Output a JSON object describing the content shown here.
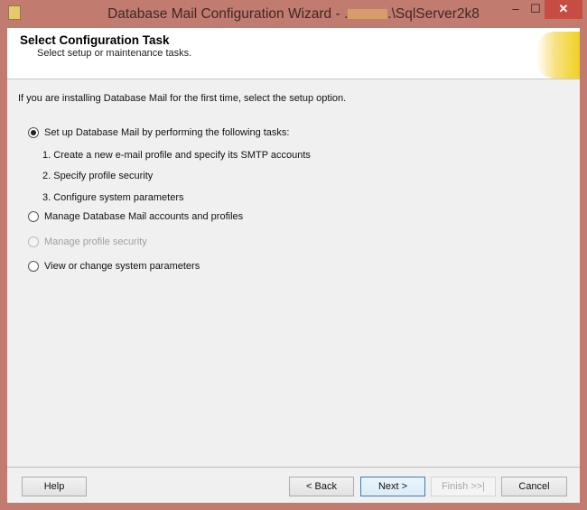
{
  "window": {
    "title_prefix": "Database Mail Configuration Wizard - .",
    "title_suffix": ".\\SqlServer2k8",
    "minimize": "‒",
    "maximize": "☐",
    "close": "✕"
  },
  "header": {
    "title": "Select Configuration Task",
    "subtitle": "Select setup or maintenance tasks."
  },
  "intro": "If you are installing Database Mail for the first time, select the setup option.",
  "options": [
    {
      "label": "Set up Database Mail by performing the following tasks:",
      "selected": true,
      "enabled": true
    },
    {
      "label": "Manage Database Mail accounts and profiles",
      "selected": false,
      "enabled": true
    },
    {
      "label": "Manage profile security",
      "selected": false,
      "enabled": false
    },
    {
      "label": "View or change system parameters",
      "selected": false,
      "enabled": true
    }
  ],
  "steps": [
    "1. Create a new e-mail profile and specify its SMTP accounts",
    "2. Specify profile security",
    "3. Configure system parameters"
  ],
  "buttons": {
    "help": "Help",
    "back": "< Back",
    "next": "Next >",
    "finish": "Finish >>|",
    "cancel": "Cancel"
  }
}
